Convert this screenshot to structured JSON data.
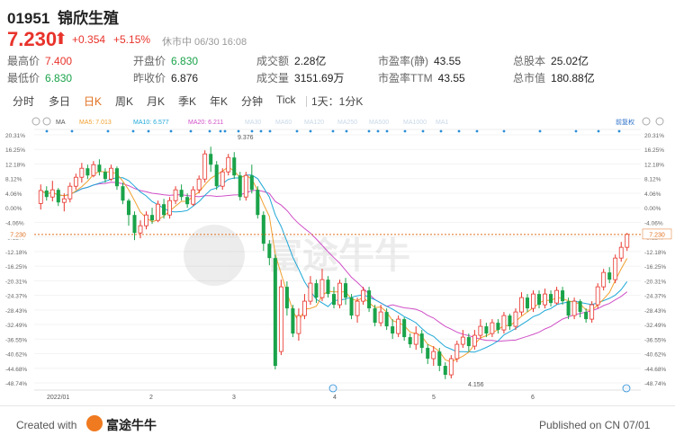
{
  "header": {
    "code": "01951",
    "name": "锦欣生殖",
    "price": "7.230",
    "change": "+0.354",
    "change_pct": "+5.15%",
    "status": "休市中 06/30 16:08"
  },
  "stats": [
    {
      "label": "最高价",
      "value": "7.400",
      "tone": "up"
    },
    {
      "label": "开盘价",
      "value": "6.830",
      "tone": "dn"
    },
    {
      "label": "成交额",
      "value": "2.28亿",
      "tone": ""
    },
    {
      "label": "市盈率(静)",
      "value": "43.55",
      "tone": ""
    },
    {
      "label": "总股本",
      "value": "25.02亿",
      "tone": ""
    },
    {
      "label": "最低价",
      "value": "6.830",
      "tone": "dn"
    },
    {
      "label": "昨收价",
      "value": "6.876",
      "tone": ""
    },
    {
      "label": "成交量",
      "value": "3151.69万",
      "tone": ""
    },
    {
      "label": "市盈率TTM",
      "value": "43.55",
      "tone": ""
    },
    {
      "label": "总市值",
      "value": "180.88亿",
      "tone": ""
    }
  ],
  "tabs": [
    "分时",
    "多日",
    "日K",
    "周K",
    "月K",
    "季K",
    "年K",
    "分钟",
    "Tick",
    "1天：1分K"
  ],
  "active_tab": "日K",
  "legend": {
    "ma": "MA",
    "ma5": "MA5: 7.013",
    "ma10": "MA10: 6.577",
    "ma20": "MA20: 6.211",
    "faded": [
      "MA30",
      "MA60",
      "MA120",
      "MA250",
      "MA500",
      "MA1000",
      "MA1"
    ],
    "right": "前复权"
  },
  "colors": {
    "up": "#e8332b",
    "down": "#1aa34a",
    "ma5": "#f0a030",
    "ma10": "#20a8d8",
    "ma20": "#d050c8",
    "marker": "#2a8fd8",
    "current_line": "#e07020"
  },
  "chart_data": {
    "type": "candlestick",
    "y_axis_left": [
      "20.31%",
      "16.25%",
      "12.18%",
      "8.12%",
      "4.06%",
      "0.00%",
      "-4.06%",
      "-8.12%",
      "-12.18%",
      "-16.25%",
      "-20.31%",
      "-24.37%",
      "-28.43%",
      "-32.49%",
      "-36.55%",
      "-40.62%",
      "-44.68%",
      "-48.74%"
    ],
    "y_axis_right": [
      "20.31%",
      "16.25%",
      "12.18%",
      "8.12%",
      "4.06%",
      "0.00%",
      "-4.06%",
      "-8.12%",
      "-12.18%",
      "-16.25%",
      "-20.31%",
      "-24.37%",
      "-28.43%",
      "-32.49%",
      "-36.55%",
      "-40.62%",
      "-44.68%",
      "-48.74%"
    ],
    "x_labels": [
      "2022/01",
      "2",
      "3",
      "4",
      "5",
      "6"
    ],
    "current_price_label": "7.230",
    "high_label": "9.376",
    "low_label": "4.156",
    "ylim_pct": [
      -48.74,
      20.31
    ],
    "current_pct": -7.44,
    "candles": [
      [
        1.2,
        4.8,
        6.5,
        -0.5
      ],
      [
        4.8,
        3.0,
        6.0,
        2.0
      ],
      [
        3.0,
        5.0,
        7.5,
        1.8
      ],
      [
        5.0,
        1.5,
        5.5,
        0.5
      ],
      [
        1.5,
        2.5,
        4.0,
        -1.0
      ],
      [
        2.5,
        6.0,
        7.0,
        1.5
      ],
      [
        6.0,
        8.5,
        9.5,
        5.0
      ],
      [
        8.5,
        11.0,
        12.5,
        7.0
      ],
      [
        11.0,
        9.0,
        12.0,
        8.0
      ],
      [
        9.0,
        12.0,
        13.0,
        8.5
      ],
      [
        12.0,
        10.0,
        13.5,
        9.0
      ],
      [
        10.0,
        8.0,
        11.0,
        7.0
      ],
      [
        8.0,
        11.0,
        12.0,
        7.5
      ],
      [
        11.0,
        6.0,
        11.5,
        5.0
      ],
      [
        6.0,
        2.0,
        7.0,
        1.0
      ],
      [
        2.0,
        -2.0,
        2.5,
        -5.0
      ],
      [
        -2.0,
        -7.0,
        -1.0,
        -9.0
      ],
      [
        -7.0,
        -5.0,
        -3.5,
        -8.5
      ],
      [
        -5.0,
        -2.0,
        -1.0,
        -6.0
      ],
      [
        -2.0,
        -3.5,
        0.0,
        -4.5
      ],
      [
        -3.5,
        1.0,
        2.0,
        -4.0
      ],
      [
        1.0,
        -2.0,
        2.5,
        -3.0
      ],
      [
        -2.0,
        2.0,
        3.0,
        -3.0
      ],
      [
        2.0,
        5.0,
        6.0,
        1.0
      ],
      [
        5.0,
        3.0,
        6.5,
        2.0
      ],
      [
        3.0,
        1.0,
        4.0,
        0.0
      ],
      [
        1.0,
        5.0,
        6.0,
        0.5
      ],
      [
        5.0,
        8.0,
        9.0,
        4.0
      ],
      [
        8.0,
        15.0,
        16.0,
        7.0
      ],
      [
        15.0,
        12.0,
        17.0,
        10.0
      ],
      [
        12.0,
        6.0,
        13.0,
        5.0
      ],
      [
        6.0,
        10.0,
        11.0,
        5.0
      ],
      [
        10.0,
        14.0,
        15.0,
        9.0
      ],
      [
        14.0,
        9.0,
        15.5,
        8.0
      ],
      [
        9.0,
        3.0,
        10.0,
        2.0
      ],
      [
        3.0,
        9.0,
        10.0,
        2.0
      ],
      [
        9.0,
        5.0,
        12.0,
        4.0
      ],
      [
        5.0,
        -2.0,
        6.0,
        -3.0
      ],
      [
        -2.0,
        -10.0,
        -1.0,
        -12.0
      ],
      [
        -10.0,
        -14.0,
        -9.0,
        -16.0
      ],
      [
        -14.0,
        -44.0,
        -13.0,
        -45.0
      ],
      [
        -40.0,
        -22.0,
        -20.0,
        -41.0
      ],
      [
        -22.0,
        -28.0,
        -20.5,
        -30.0
      ],
      [
        -28.0,
        -35.0,
        -27.0,
        -36.0
      ],
      [
        -35.0,
        -30.0,
        -28.0,
        -37.0
      ],
      [
        -30.0,
        -26.0,
        -24.0,
        -31.0
      ],
      [
        -26.0,
        -21.0,
        -19.0,
        -27.0
      ],
      [
        -21.0,
        -25.0,
        -20.0,
        -26.5
      ],
      [
        -25.0,
        -20.0,
        -17.0,
        -26.0
      ],
      [
        -20.0,
        -24.0,
        -19.0,
        -25.0
      ],
      [
        -24.0,
        -27.0,
        -22.0,
        -28.0
      ],
      [
        -27.0,
        -21.0,
        -20.0,
        -28.0
      ],
      [
        -21.0,
        -25.0,
        -19.5,
        -27.0
      ],
      [
        -25.0,
        -30.0,
        -24.0,
        -31.0
      ],
      [
        -30.0,
        -26.0,
        -25.0,
        -32.0
      ],
      [
        -26.0,
        -23.0,
        -22.0,
        -27.0
      ],
      [
        -23.0,
        -28.0,
        -22.0,
        -29.0
      ],
      [
        -28.0,
        -32.0,
        -27.0,
        -33.0
      ],
      [
        -32.0,
        -29.0,
        -27.0,
        -33.0
      ],
      [
        -29.0,
        -33.0,
        -28.0,
        -34.0
      ],
      [
        -33.0,
        -35.0,
        -31.0,
        -36.5
      ],
      [
        -35.0,
        -31.0,
        -30.0,
        -36.0
      ],
      [
        -31.0,
        -36.0,
        -30.5,
        -37.0
      ],
      [
        -36.0,
        -38.0,
        -35.0,
        -39.0
      ],
      [
        -38.0,
        -35.0,
        -33.0,
        -39.5
      ],
      [
        -35.0,
        -39.0,
        -34.0,
        -40.5
      ],
      [
        -39.0,
        -42.0,
        -38.0,
        -43.5
      ],
      [
        -42.0,
        -40.0,
        -38.5,
        -44.0
      ],
      [
        -40.0,
        -44.0,
        -39.0,
        -45.5
      ],
      [
        -44.0,
        -46.5,
        -43.0,
        -47.7
      ],
      [
        -46.5,
        -42.0,
        -41.0,
        -47.5
      ],
      [
        -42.0,
        -38.0,
        -37.0,
        -43.0
      ],
      [
        -38.0,
        -36.0,
        -34.0,
        -39.0
      ],
      [
        -36.0,
        -38.5,
        -35.0,
        -40.0
      ],
      [
        -38.5,
        -35.5,
        -34.0,
        -39.5
      ],
      [
        -35.5,
        -33.0,
        -31.0,
        -36.5
      ],
      [
        -33.0,
        -35.0,
        -32.0,
        -36.0
      ],
      [
        -35.0,
        -32.0,
        -31.0,
        -36.0
      ],
      [
        -32.0,
        -34.0,
        -31.0,
        -35.0
      ],
      [
        -34.0,
        -30.0,
        -29.0,
        -35.0
      ],
      [
        -30.0,
        -33.0,
        -29.5,
        -34.0
      ],
      [
        -33.0,
        -29.0,
        -28.0,
        -34.0
      ],
      [
        -29.0,
        -25.0,
        -23.5,
        -30.0
      ],
      [
        -25.0,
        -28.0,
        -24.0,
        -29.0
      ],
      [
        -28.0,
        -24.0,
        -23.0,
        -29.0
      ],
      [
        -24.0,
        -27.0,
        -23.0,
        -28.0
      ],
      [
        -27.0,
        -24.0,
        -22.5,
        -28.0
      ],
      [
        -24.0,
        -26.5,
        -23.0,
        -27.5
      ],
      [
        -26.5,
        -23.0,
        -22.0,
        -27.0
      ],
      [
        -23.0,
        -26.0,
        -22.0,
        -27.0
      ],
      [
        -26.0,
        -30.0,
        -25.0,
        -31.0
      ],
      [
        -30.0,
        -26.0,
        -25.0,
        -31.0
      ],
      [
        -26.0,
        -29.0,
        -25.5,
        -30.5
      ],
      [
        -29.0,
        -31.0,
        -28.0,
        -32.0
      ],
      [
        -31.0,
        -27.0,
        -26.0,
        -32.0
      ],
      [
        -27.0,
        -22.0,
        -21.0,
        -28.0
      ],
      [
        -22.0,
        -18.0,
        -17.0,
        -23.0
      ],
      [
        -18.0,
        -20.0,
        -16.5,
        -21.0
      ],
      [
        -20.0,
        -14.0,
        -13.0,
        -21.0
      ],
      [
        -14.0,
        -11.0,
        -9.5,
        -15.0
      ],
      [
        -11.0,
        -7.4,
        -7.0,
        -12.0
      ]
    ]
  },
  "footer": {
    "created_with": "Created with",
    "brand": "富途牛牛",
    "published": "Published on CN 07/01"
  },
  "watermark": "富途牛牛"
}
